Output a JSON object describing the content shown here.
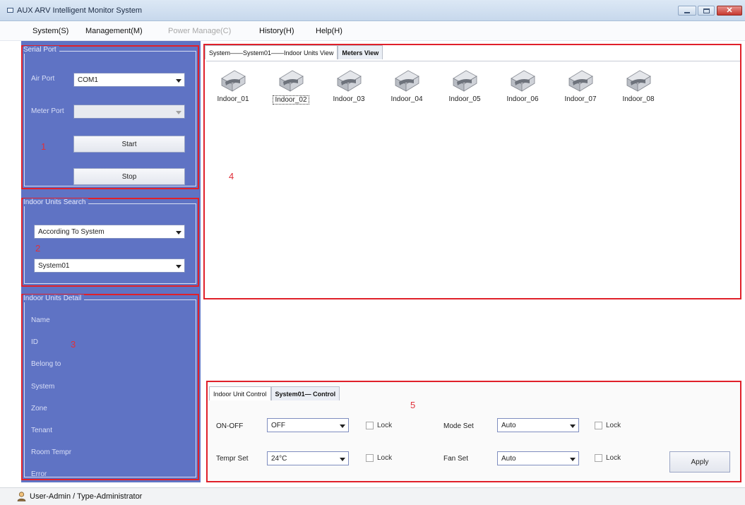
{
  "window": {
    "title": "AUX ARV Intelligent Monitor System",
    "icon": "app-icon",
    "buttons": [
      "minimize-icon",
      "maximize-icon",
      "close-icon"
    ]
  },
  "menu": {
    "items": [
      {
        "label": "System(S)",
        "enabled": true
      },
      {
        "label": "Management(M)",
        "enabled": true
      },
      {
        "label": "Power Manage(C)",
        "enabled": false
      },
      {
        "label": "History(H)",
        "enabled": true
      },
      {
        "label": "Help(H)",
        "enabled": true
      }
    ]
  },
  "serial_port": {
    "title": "Serial Port",
    "air_port_label": "Air Port",
    "air_port_value": "COM1",
    "meter_port_label": "Meter Port",
    "meter_port_value": "",
    "start_label": "Start",
    "stop_label": "Stop",
    "marker": "1"
  },
  "search": {
    "title": "Indoor Units Search",
    "mode_value": "According To System",
    "system_value": "System01",
    "marker": "2"
  },
  "detail": {
    "title": "Indoor Units Detail",
    "fields": [
      "Name",
      "ID",
      "Belong to",
      "System",
      "Zone",
      "Tenant",
      "Room Tempr",
      "Error"
    ],
    "marker": "3"
  },
  "view": {
    "tab_breadcrumb": "System——System01——Indoor Units View",
    "tab_meters": "Meters View",
    "units": [
      "Indoor_01",
      "Indoor_02",
      "Indoor_03",
      "Indoor_04",
      "Indoor_05",
      "Indoor_06",
      "Indoor_07",
      "Indoor_08"
    ],
    "selected_unit": "Indoor_02",
    "marker": "4"
  },
  "control": {
    "tab_unit": "Indoor Unit Control",
    "tab_system": "System01— Control",
    "marker": "5",
    "onoff_label": "ON-OFF",
    "onoff_value": "OFF",
    "tempr_label": "Tempr Set",
    "tempr_value": "24°C",
    "mode_label": "Mode Set",
    "mode_value": "Auto",
    "fan_label": "Fan Set",
    "fan_value": "Auto",
    "lock_label": "Lock",
    "apply_label": "Apply"
  },
  "status": {
    "text": "User-Admin / Type-Administrator",
    "icon": "user-icon"
  },
  "colors": {
    "panel_bg": "#5f73c4",
    "annotation_red": "#e0202a"
  }
}
